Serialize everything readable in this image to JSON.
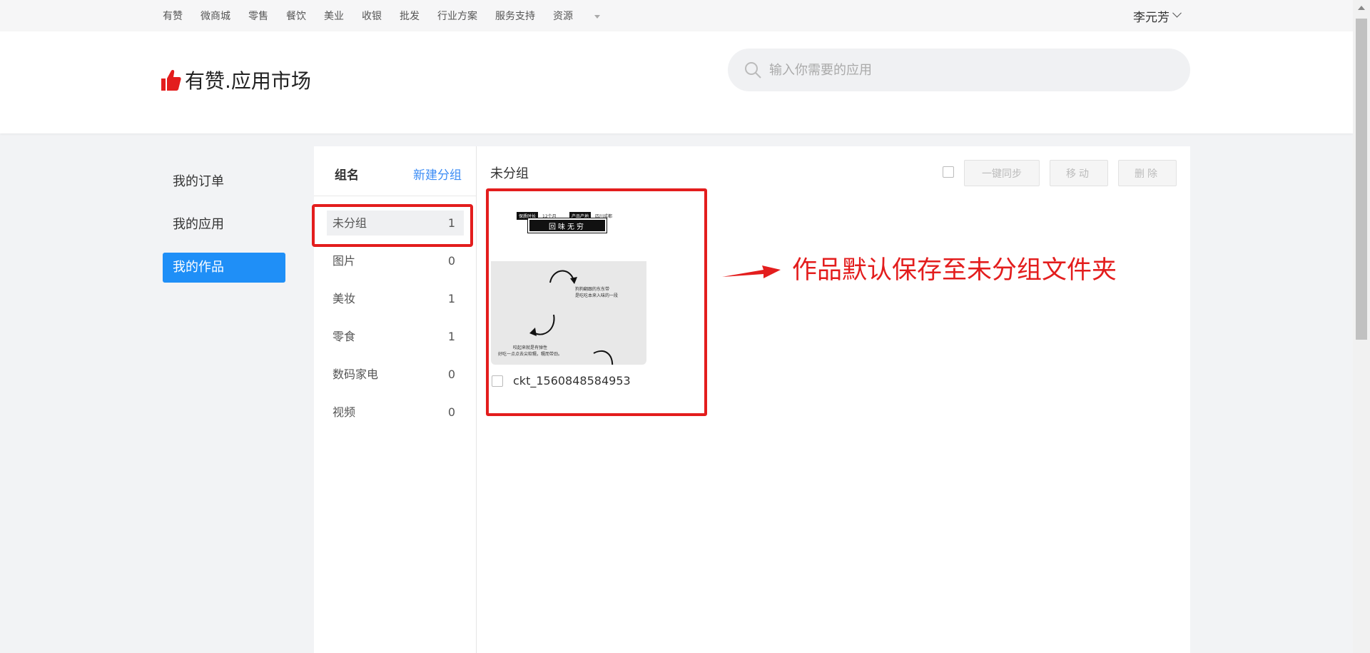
{
  "topnav": {
    "links": [
      "有赞",
      "微商城",
      "零售",
      "餐饮",
      "美业",
      "收银",
      "批发",
      "行业方案",
      "服务支持",
      "资源"
    ],
    "user": "李元芳"
  },
  "header": {
    "logo": "有赞.应用市场",
    "search_placeholder": "输入你需要的应用"
  },
  "leftmenu": {
    "items": [
      {
        "label": "我的订单"
      },
      {
        "label": "我的应用"
      },
      {
        "label": "我的作品",
        "active": true
      }
    ]
  },
  "groups": {
    "header": "组名",
    "new_group": "新建分组",
    "items": [
      {
        "name": "未分组",
        "count": "1"
      },
      {
        "name": "图片",
        "count": "0"
      },
      {
        "name": "美妆",
        "count": "1"
      },
      {
        "name": "零食",
        "count": "1"
      },
      {
        "name": "数码家电",
        "count": "0"
      },
      {
        "name": "视频",
        "count": "0"
      }
    ]
  },
  "content": {
    "title": "未分组",
    "btn_sync": "一键同步",
    "btn_move": "移动",
    "btn_delete": "删除",
    "card": {
      "name": "ckt_1560848584953",
      "tag1": "保质时长",
      "tag1_value": "12个月",
      "tag2": "产品产地",
      "tag2_value": "四川成都",
      "ribbon": "回味无穷",
      "caption1": "狗狗翻跟的东东带\n是吃吃本来入味的一段",
      "caption2": "咬起来就是有弹性\n好吃一点点去尖软糯，糯而带劲。"
    }
  },
  "annotation": {
    "text": "作品默认保存至未分组文件夹",
    "color": "#e31d1d"
  },
  "colors": {
    "accent": "#1f8ff7",
    "link": "#3c8cf5",
    "highlight": "#e31d1d"
  }
}
